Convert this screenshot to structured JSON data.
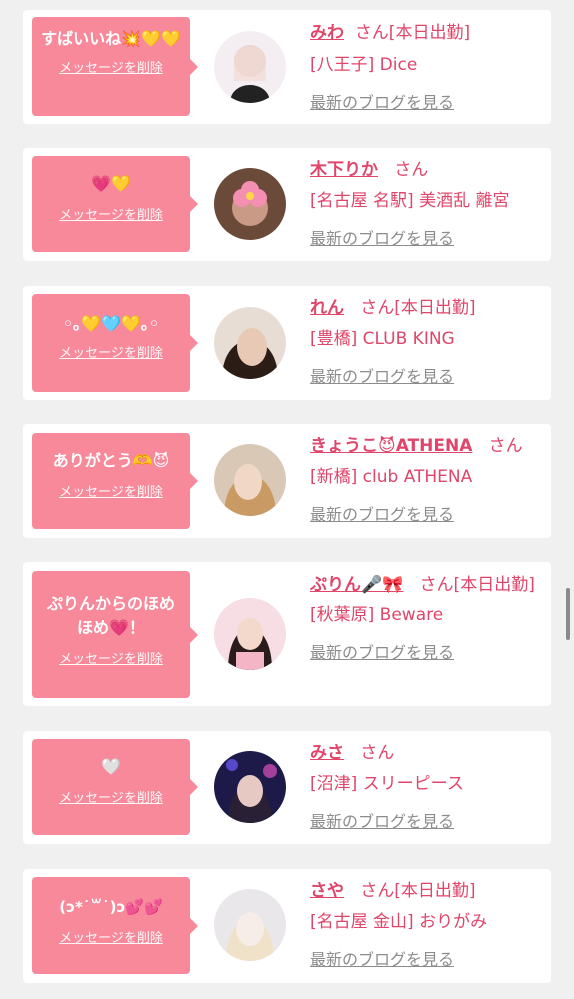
{
  "cards": [
    {
      "message": "すばいいね💥💛💛",
      "delete_label": "メッセージを削除",
      "name": "みわ",
      "suffix": "さん[本日出勤]",
      "shop": "[八王子] Dice",
      "blog_label": "最新のブログを見る"
    },
    {
      "message": "💗💛",
      "delete_label": "メッセージを削除",
      "name": "木下りか",
      "suffix": "さん",
      "shop": "[名古屋 名駅] 美酒乱 離宮",
      "blog_label": "最新のブログを見る"
    },
    {
      "message": "◦｡💛🩵💛｡◦",
      "delete_label": "メッセージを削除",
      "name": "れん",
      "suffix": "さん[本日出勤]",
      "shop": "[豊橋] CLUB KING",
      "blog_label": "最新のブログを見る"
    },
    {
      "message": "ありがとう🫶😈",
      "delete_label": "メッセージを削除",
      "name": "きょうこ😈ATHENA",
      "suffix": "さん",
      "shop": "[新橋] club ATHENA",
      "blog_label": "最新のブログを見る"
    },
    {
      "message": "ぷりんからのほめほめ💗！",
      "delete_label": "メッセージを削除",
      "name": "ぷりん🎤🎀",
      "suffix": "さん[本日出勤]",
      "shop": "[秋葉原] Beware",
      "blog_label": "最新のブログを見る"
    },
    {
      "message": "🤍",
      "delete_label": "メッセージを削除",
      "name": "みさ",
      "suffix": "さん",
      "shop": "[沼津] スリーピース",
      "blog_label": "最新のブログを見る"
    },
    {
      "message": "(ↄ*˙꒳˙)ↄ💕💕",
      "delete_label": "メッセージを削除",
      "name": "さや",
      "suffix": "さん[本日出勤]",
      "shop": "[名古屋 金山] おりがみ",
      "blog_label": "最新のブログを見る"
    }
  ],
  "colors": {
    "accent": "#e0456a",
    "bubble": "#f7899a",
    "link_gray": "#8c8c8c",
    "background": "#f0f0f0"
  }
}
